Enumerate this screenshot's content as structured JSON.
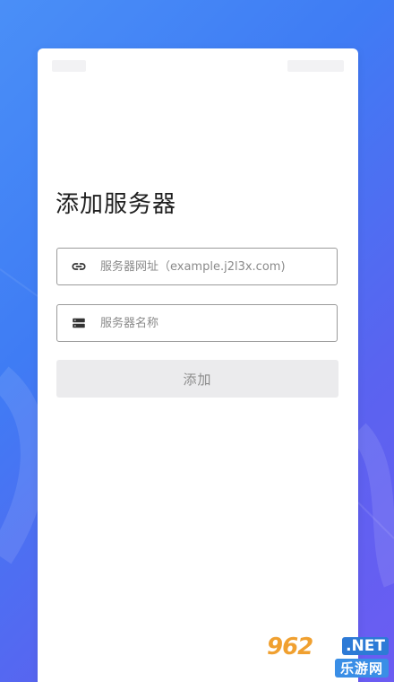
{
  "page": {
    "title": "添加服务器"
  },
  "form": {
    "url_field": {
      "value": "",
      "placeholder": "服务器网址（example.j2l3x.com)"
    },
    "name_field": {
      "value": "",
      "placeholder": "服务器名称"
    },
    "add_label": "添加"
  },
  "icons": {
    "url": "link-icon",
    "name": "server-icon"
  },
  "watermark": {
    "logo": "962",
    "net": ".NET",
    "sub": "乐游网"
  },
  "colors": {
    "background_start": "#4a8ff7",
    "background_end": "#6c5cf2",
    "button_disabled_bg": "#ebebed",
    "button_disabled_text": "#8c8c8c"
  }
}
